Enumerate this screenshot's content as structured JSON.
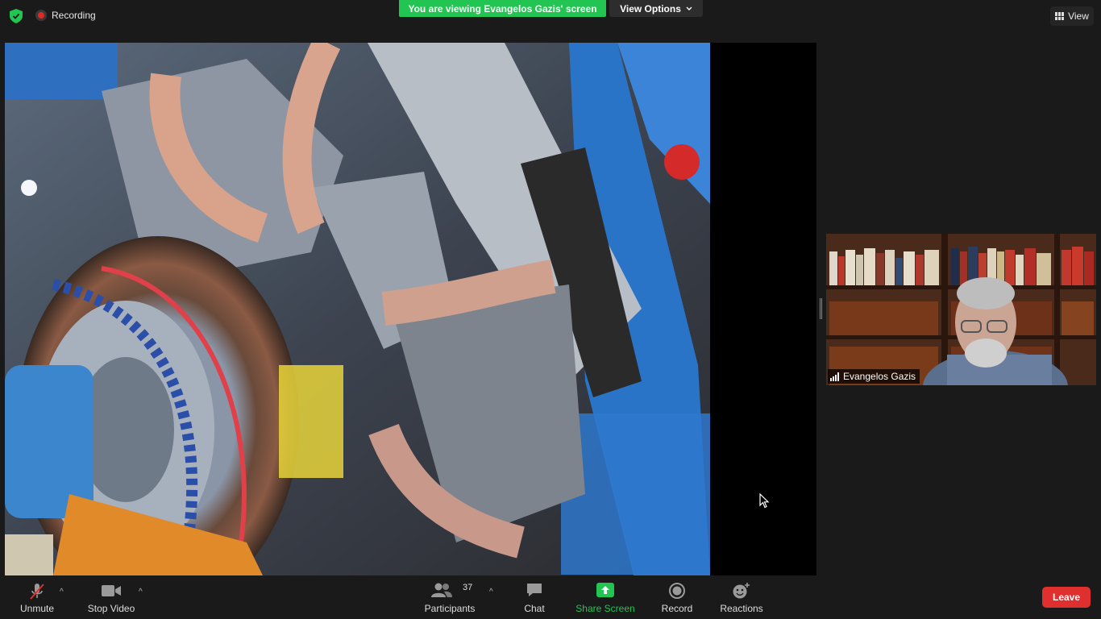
{
  "top_bar": {
    "recording_label": "Recording",
    "viewing_banner": "You are viewing Evangelos Gazis' screen",
    "view_options_label": "View Options",
    "view_label": "View"
  },
  "participant": {
    "name": "Evangelos Gazis"
  },
  "toolbar": {
    "unmute_label": "Unmute",
    "stop_video_label": "Stop Video",
    "participants_label": "Participants",
    "participants_count": "37",
    "chat_label": "Chat",
    "share_screen_label": "Share Screen",
    "record_label": "Record",
    "reactions_label": "Reactions",
    "leave_label": "Leave"
  },
  "colors": {
    "accent_green": "#23c552",
    "leave_red": "#e02f2f",
    "background": "#1a1a1a"
  }
}
